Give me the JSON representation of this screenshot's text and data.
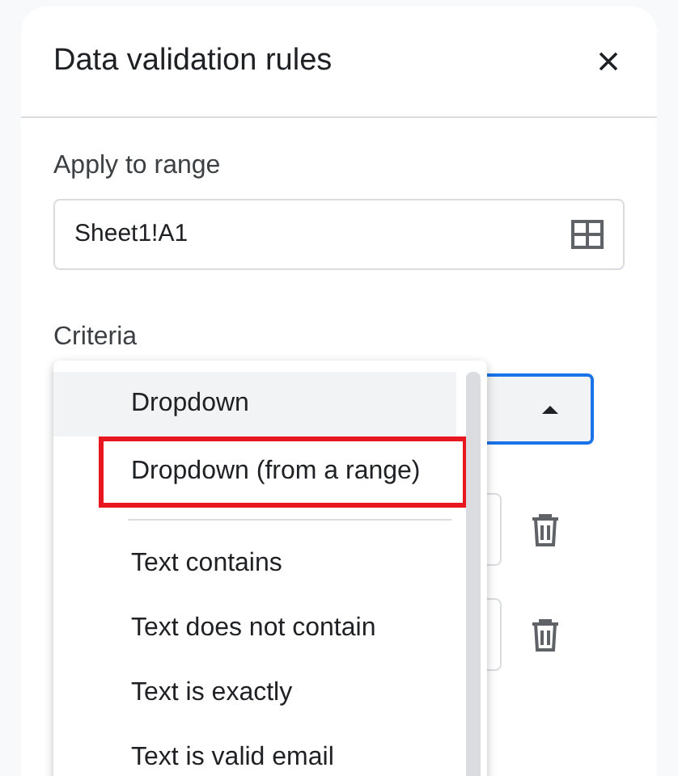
{
  "panel": {
    "title": "Data validation rules",
    "range_label": "Apply to range",
    "range_value": "Sheet1!A1",
    "criteria_label": "Criteria"
  },
  "menu": {
    "groups": [
      [
        {
          "label": "Dropdown",
          "selected": true,
          "highlighted": false
        },
        {
          "label": "Dropdown (from a range)",
          "selected": false,
          "highlighted": true
        }
      ],
      [
        {
          "label": "Text contains",
          "selected": false,
          "highlighted": false
        },
        {
          "label": "Text does not contain",
          "selected": false,
          "highlighted": false
        },
        {
          "label": "Text is exactly",
          "selected": false,
          "highlighted": false
        },
        {
          "label": "Text is valid email",
          "selected": false,
          "highlighted": false
        }
      ]
    ]
  }
}
